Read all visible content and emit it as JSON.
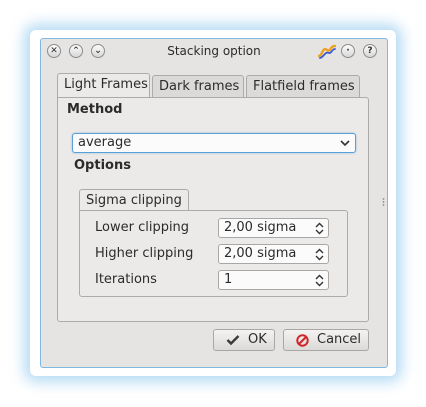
{
  "window": {
    "title": "Stacking option",
    "titlebar_buttons": [
      "close-icon",
      "chevron-up-icon",
      "chevron-down-icon",
      "app-icon",
      "minimize-icon",
      "help-icon"
    ],
    "help_glyph": "?"
  },
  "tabs": [
    {
      "label": "Light Frames",
      "active": true
    },
    {
      "label": "Dark frames",
      "active": false
    },
    {
      "label": "Flatfield frames",
      "active": false
    }
  ],
  "method": {
    "label": "Method",
    "selected": "average"
  },
  "options": {
    "label": "Options",
    "group_tab": "Sigma clipping",
    "rows": [
      {
        "label": "Lower clipping",
        "value": "2,00 sigma"
      },
      {
        "label": "Higher clipping",
        "value": "2,00 sigma"
      },
      {
        "label": "Iterations",
        "value": "1"
      }
    ]
  },
  "buttons": {
    "ok": "OK",
    "cancel": "Cancel"
  },
  "colors": {
    "focus_border": "#5aa0d6",
    "ok_check": "#3a3a3a",
    "cancel_icon": "#d0262b",
    "window_glow": "#78beeb"
  }
}
